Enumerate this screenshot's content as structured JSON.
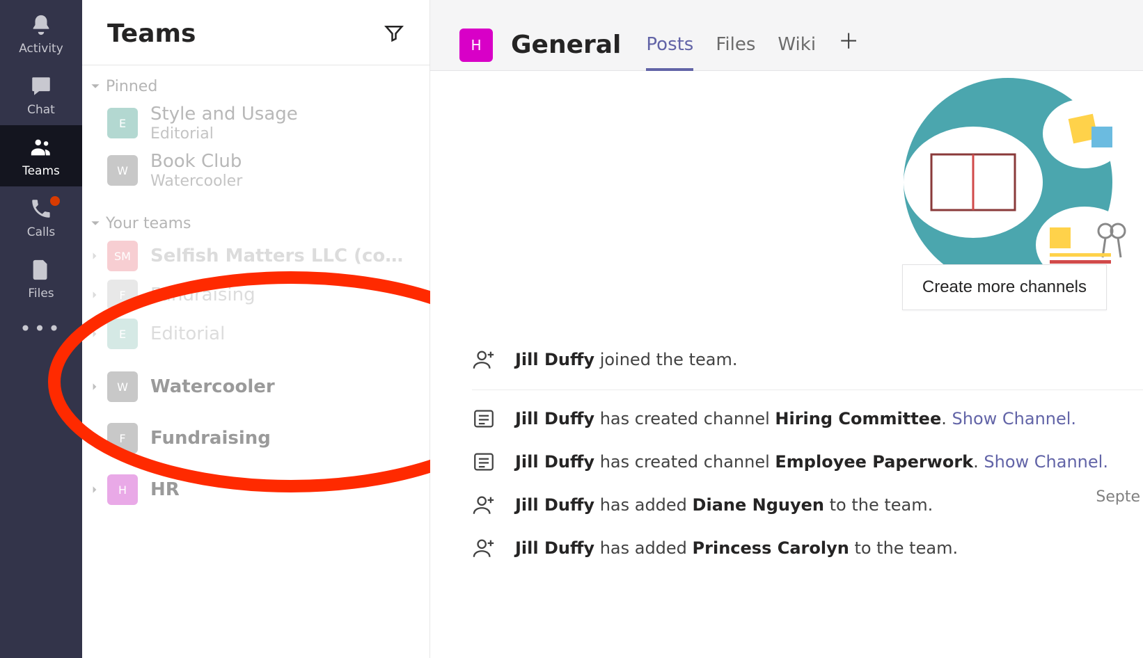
{
  "rail": {
    "items": [
      {
        "id": "activity",
        "label": "Activity"
      },
      {
        "id": "chat",
        "label": "Chat"
      },
      {
        "id": "teams",
        "label": "Teams"
      },
      {
        "id": "calls",
        "label": "Calls",
        "badge": true
      },
      {
        "id": "files",
        "label": "Files"
      }
    ],
    "active": "teams"
  },
  "panel": {
    "title": "Teams",
    "sections": {
      "pinned_label": "Pinned",
      "your_teams_label": "Your teams"
    },
    "pinned": [
      {
        "avatar_letter": "E",
        "avatar_color": "#b3d8d1",
        "name": "Style and Usage",
        "sub": "Editorial"
      },
      {
        "avatar_letter": "W",
        "avatar_color": "#c8c8c8",
        "name": "Book Club",
        "sub": "Watercooler"
      }
    ],
    "drag_group": [
      {
        "avatar_letter": "SM",
        "avatar_color": "#f2a7ae",
        "name": "Selfish Matters LLC (co…",
        "bold": true
      },
      {
        "avatar_letter": "F",
        "avatar_color": "#d6d6d6",
        "name": "Fundraising"
      },
      {
        "avatar_letter": "E",
        "avatar_color": "#b3d8d1",
        "name": "Editorial"
      }
    ],
    "other_teams": [
      {
        "avatar_letter": "W",
        "avatar_color": "#c8c8c8",
        "name": "Watercooler",
        "bold": true
      },
      {
        "avatar_letter": "F",
        "avatar_color": "#c8c8c8",
        "name": "Fundraising",
        "bold": true
      },
      {
        "avatar_letter": "H",
        "avatar_color": "#e9a9e7",
        "name": "HR",
        "bold": true
      }
    ]
  },
  "content": {
    "channel_avatar_letter": "H",
    "channel_title": "General",
    "tabs": [
      {
        "label": "Posts",
        "active": true
      },
      {
        "label": "Files"
      },
      {
        "label": "Wiki"
      }
    ],
    "create_btn": "Create more channels",
    "date_divider": "Septe",
    "feed": [
      {
        "icon": "person-add",
        "html_parts": [
          "b:Jill Duffy",
          "t: joined the team."
        ]
      },
      {
        "icon": "channel",
        "html_parts": [
          "b:Jill Duffy",
          "t: has created channel ",
          "b:Hiring Committee",
          "t:. ",
          "l:Show Channel."
        ],
        "border_top": true
      },
      {
        "icon": "channel",
        "html_parts": [
          "b:Jill Duffy",
          "t: has created channel ",
          "b:Employee Paperwork",
          "t:. ",
          "l:Show Channel."
        ]
      },
      {
        "icon": "person-add",
        "html_parts": [
          "b:Jill Duffy",
          "t: has added ",
          "b:Diane Nguyen",
          "t: to the team."
        ]
      },
      {
        "icon": "person-add",
        "html_parts": [
          "b:Jill Duffy",
          "t: has added ",
          "b:Princess Carolyn",
          "t: to the team."
        ]
      }
    ]
  }
}
